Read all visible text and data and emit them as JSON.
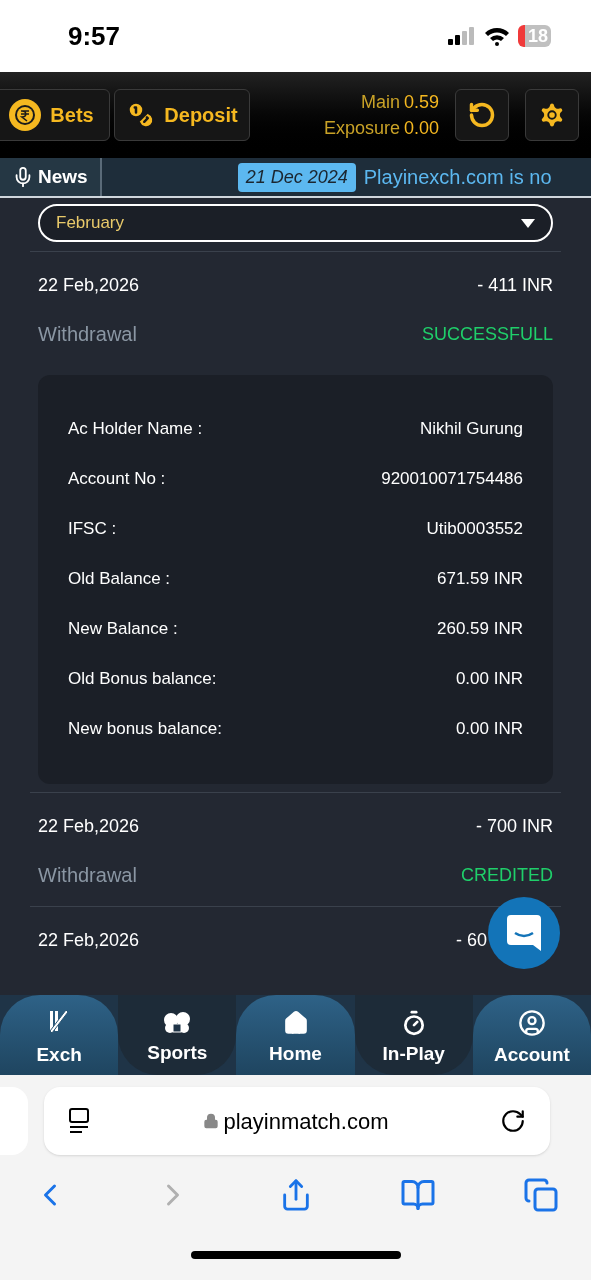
{
  "status_bar": {
    "time": "9:57",
    "battery": "18"
  },
  "header": {
    "bets_label": "Bets",
    "deposit_label": "Deposit",
    "main_label": "Main",
    "main_value": "0.59",
    "exposure_label": "Exposure",
    "exposure_value": "0.00"
  },
  "news": {
    "label": "News",
    "date": "21 Dec 2024",
    "text": "Playinexch.com is no"
  },
  "month_select": {
    "value": "February"
  },
  "transactions": [
    {
      "date": "22 Feb,2026",
      "amount": "- 411 INR",
      "type": "Withdrawal",
      "status": "SUCCESSFULL",
      "details": [
        {
          "label": "Ac Holder Name :",
          "value": "Nikhil Gurung"
        },
        {
          "label": "Account No :",
          "value": "920010071754486"
        },
        {
          "label": "IFSC :",
          "value": "Utib0003552"
        },
        {
          "label": "Old Balance :",
          "value": "671.59 INR"
        },
        {
          "label": "New Balance :",
          "value": "260.59 INR"
        },
        {
          "label": "Old Bonus balance:",
          "value": "0.00 INR"
        },
        {
          "label": "New bonus balance:",
          "value": "0.00 INR"
        }
      ]
    },
    {
      "date": "22 Feb,2026",
      "amount": "- 700 INR",
      "type": "Withdrawal",
      "status": "CREDITED"
    },
    {
      "date": "22 Feb,2026",
      "amount": "- 60"
    }
  ],
  "bottom_nav": [
    {
      "label": "Exch",
      "kind": "raised"
    },
    {
      "label": "Sports",
      "kind": "sunken"
    },
    {
      "label": "Home",
      "kind": "raised"
    },
    {
      "label": "In-Play",
      "kind": "sunken"
    },
    {
      "label": "Account",
      "kind": "raised"
    }
  ],
  "browser": {
    "url": "playinmatch.com"
  }
}
